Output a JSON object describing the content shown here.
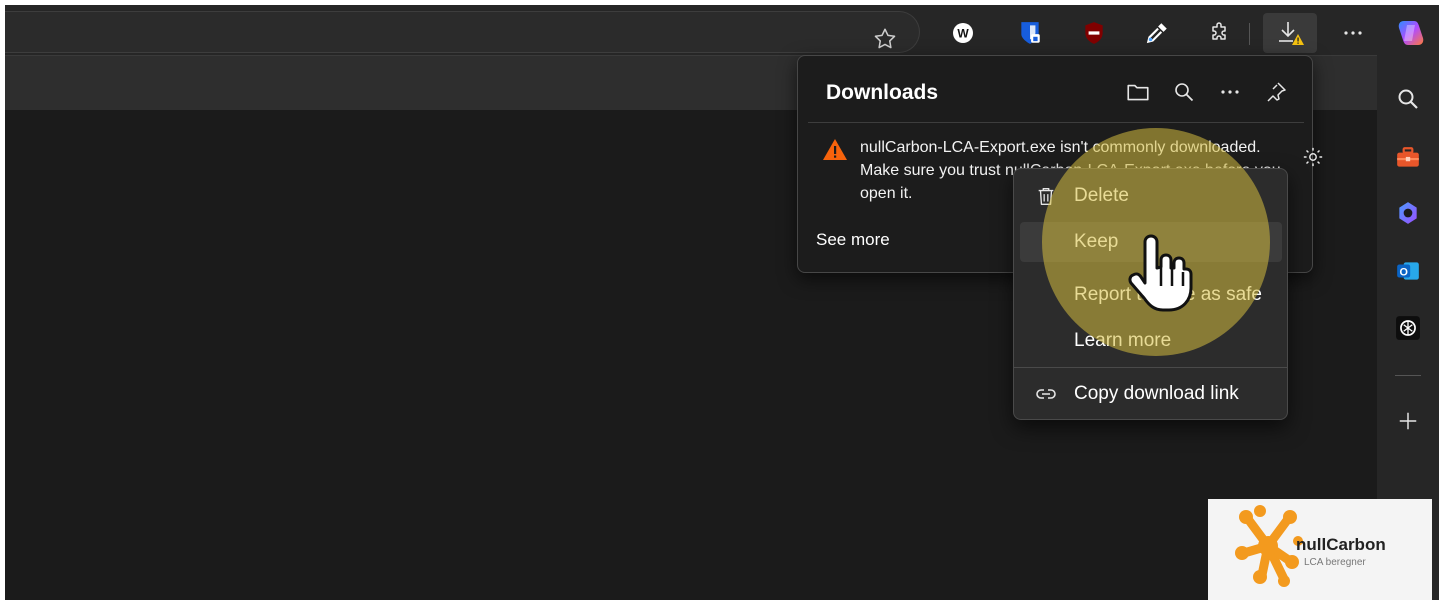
{
  "toolbar": {
    "favorite_icon": "star-icon",
    "extensions": [
      "wordtune-icon",
      "bitwarden-icon",
      "ublock-icon",
      "color-picker-icon",
      "extensions-puzzle-icon"
    ],
    "downloads_icon": "download-warning-icon",
    "more_icon": "ellipsis-icon",
    "copilot_icon": "copilot-icon"
  },
  "downloads": {
    "title": "Downloads",
    "warning_message": "nullCarbon-LCA-Export.exe isn't commonly downloaded. Make sure you trust nullCarbon-LCA-Export.exe before you open it.",
    "see_more": "See more"
  },
  "context_menu": {
    "items": [
      {
        "label": "Delete",
        "icon": "trash-icon"
      },
      {
        "label": "Keep",
        "icon": ""
      },
      {
        "label": "Report this file as safe",
        "icon": ""
      },
      {
        "label": "Learn more",
        "icon": ""
      }
    ],
    "copy_link": {
      "label": "Copy download link",
      "icon": "link-icon"
    }
  },
  "sidebar": {
    "items": [
      "search-icon",
      "toolbox-icon",
      "copilot-icon",
      "outlook-icon",
      "chatgpt-icon"
    ],
    "add_icon": "plus-icon"
  },
  "logo": {
    "name": "nullCarbon",
    "tagline": "LCA beregner"
  },
  "colors": {
    "warning": "#f7630c",
    "highlight": "#d6be40",
    "logo_orange": "#f39a1e"
  }
}
